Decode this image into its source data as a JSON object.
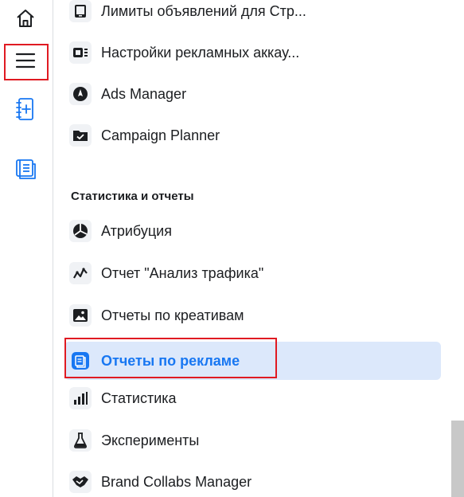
{
  "rail": {
    "items": [
      {
        "name": "home",
        "icon": "home-icon"
      },
      {
        "name": "menu",
        "icon": "hamburger-menu-icon"
      },
      {
        "name": "create-ad",
        "icon": "notebook-plus-icon"
      },
      {
        "name": "reports",
        "icon": "reports-stack-icon"
      }
    ]
  },
  "menu": {
    "items_top": [
      {
        "label": "Лимиты объявлений для Стр...",
        "icon": "tablet-icon"
      },
      {
        "label": "Настройки рекламных аккау...",
        "icon": "ad-account-settings-icon"
      },
      {
        "label": "Ads Manager",
        "icon": "compass-icon"
      },
      {
        "label": "Campaign Planner",
        "icon": "folder-check-icon"
      }
    ],
    "section_title": "Статистика и отчеты",
    "items_stats": [
      {
        "label": "Атрибуция",
        "icon": "attribution-pie-icon"
      },
      {
        "label": "Отчет \"Анализ трафика\"",
        "icon": "traffic-trend-icon"
      },
      {
        "label": "Отчеты по креативам",
        "icon": "image-icon"
      },
      {
        "label": "Отчеты по рекламе",
        "icon": "ads-reports-icon",
        "active": true
      },
      {
        "label": "Статистика",
        "icon": "bar-chart-icon"
      },
      {
        "label": "Эксперименты",
        "icon": "flask-icon"
      },
      {
        "label": "Brand Collabs Manager",
        "icon": "handshake-icon"
      }
    ]
  },
  "colors": {
    "accent": "#1877f2",
    "active_bg": "#dce8fb",
    "highlight_box": "#e01a22",
    "text": "#1c1e21"
  }
}
